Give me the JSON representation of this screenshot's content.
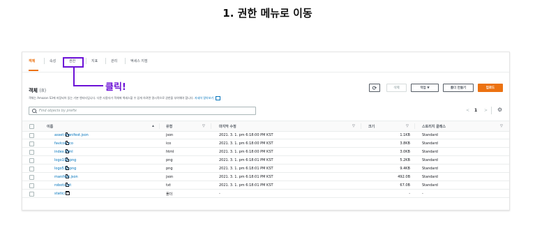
{
  "heading": "1. 권한 메뉴로 이동",
  "tabs": [
    {
      "label": "객체",
      "active": true
    },
    {
      "label": "속성",
      "active": false
    },
    {
      "label": "권한",
      "active": false
    },
    {
      "label": "지표",
      "active": false
    },
    {
      "label": "관리",
      "active": false
    },
    {
      "label": "액세스 지점",
      "active": false
    }
  ],
  "callout": "클릭!",
  "objects": {
    "title": "객체",
    "count": "(8)",
    "description": "객체는 Amazon S3에 저장되어 있는 기본 엔티티입니다. 다른 사용자가 객체에 액세스할 수 있게 하려면 명시적으로 권한을 부여해야 합니다.",
    "learn_more": "자세히 알아보기"
  },
  "toolbar": {
    "refresh_icon": "refresh-icon",
    "delete": "삭제",
    "actions": "작업 ▼",
    "create_folder": "폴더 만들기",
    "upload": "업로드"
  },
  "search": {
    "placeholder": "Find objects by prefix"
  },
  "pagination": {
    "prev": "<",
    "page": "1",
    "next": ">"
  },
  "columns": [
    "이름",
    "유형",
    "마지막 수정",
    "크기",
    "스토리지 클래스"
  ],
  "rows": [
    {
      "name": "asset-manifest.json",
      "type": "json",
      "modified": "2021. 3. 1. pm 6:18:00 PM KST",
      "size": "1.1KB",
      "storage": "Standard",
      "kind": "file"
    },
    {
      "name": "favicon.ico",
      "type": "ico",
      "modified": "2021. 3. 1. pm 6:18:00 PM KST",
      "size": "3.8KB",
      "storage": "Standard",
      "kind": "file"
    },
    {
      "name": "index.html",
      "type": "html",
      "modified": "2021. 3. 1. pm 6:18:00 PM KST",
      "size": "3.0KB",
      "storage": "Standard",
      "kind": "file"
    },
    {
      "name": "logo192.png",
      "type": "png",
      "modified": "2021. 3. 1. pm 6:18:01 PM KST",
      "size": "5.2KB",
      "storage": "Standard",
      "kind": "file"
    },
    {
      "name": "logo512.png",
      "type": "png",
      "modified": "2021. 3. 1. pm 6:18:01 PM KST",
      "size": "9.4KB",
      "storage": "Standard",
      "kind": "file"
    },
    {
      "name": "manifest.json",
      "type": "json",
      "modified": "2021. 3. 1. pm 6:18:01 PM KST",
      "size": "492.0B",
      "storage": "Standard",
      "kind": "file"
    },
    {
      "name": "robots.txt",
      "type": "txt",
      "modified": "2021. 3. 1. pm 6:18:01 PM KST",
      "size": "67.0B",
      "storage": "Standard",
      "kind": "file"
    },
    {
      "name": "static/",
      "type": "폴더",
      "modified": "-",
      "size": "-",
      "storage": "-",
      "kind": "folder"
    }
  ],
  "colors": {
    "accent": "#ec7211",
    "link": "#0073bb",
    "callout": "#6b10d6"
  }
}
